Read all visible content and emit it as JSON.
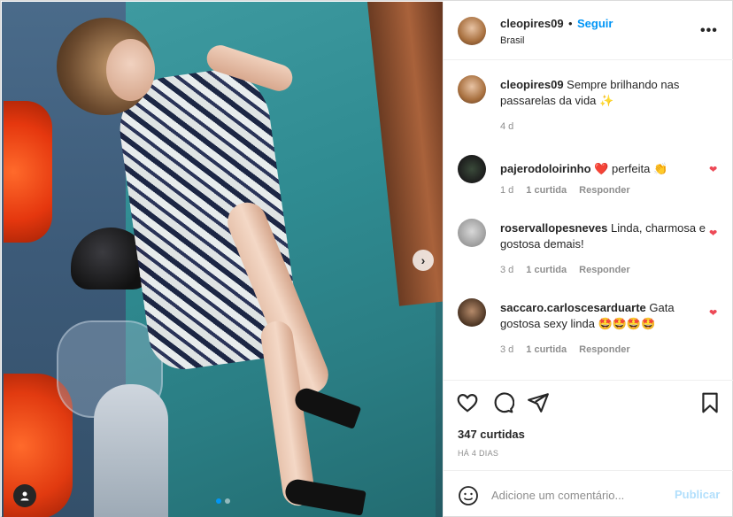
{
  "post": {
    "author": "cleopires09",
    "separator": "•",
    "follow_label": "Seguir",
    "location": "Brasil",
    "more_label": "•••",
    "next_label": "›",
    "caption": "Sempre brilhando nas passarelas da vida ✨",
    "caption_time": "4 d"
  },
  "comments": [
    {
      "user": "pajerodoloirinho",
      "text": "❤️ perfeita 👏",
      "time": "1 d",
      "likes": "1 curtida",
      "reply": "Responder"
    },
    {
      "user": "roservallopesneves",
      "text": "Linda, charmosa e gostosa demais!",
      "time": "3 d",
      "likes": "1 curtida",
      "reply": "Responder"
    },
    {
      "user": "saccaro.carloscesarduarte",
      "text": "Gata gostosa sexy linda 🤩🤩🤩🤩",
      "time": "3 d",
      "likes": "1 curtida",
      "reply": "Responder"
    }
  ],
  "stats": {
    "likes": "347 curtidas",
    "date": "HÁ 4 DIAS"
  },
  "composer": {
    "placeholder": "Adicione um comentário...",
    "publish": "Publicar"
  },
  "colors": {
    "accent": "#0095f6",
    "heart": "#ed4956",
    "muted": "#8e8e8e"
  },
  "carousel": {
    "slides": 2,
    "active": 1
  }
}
